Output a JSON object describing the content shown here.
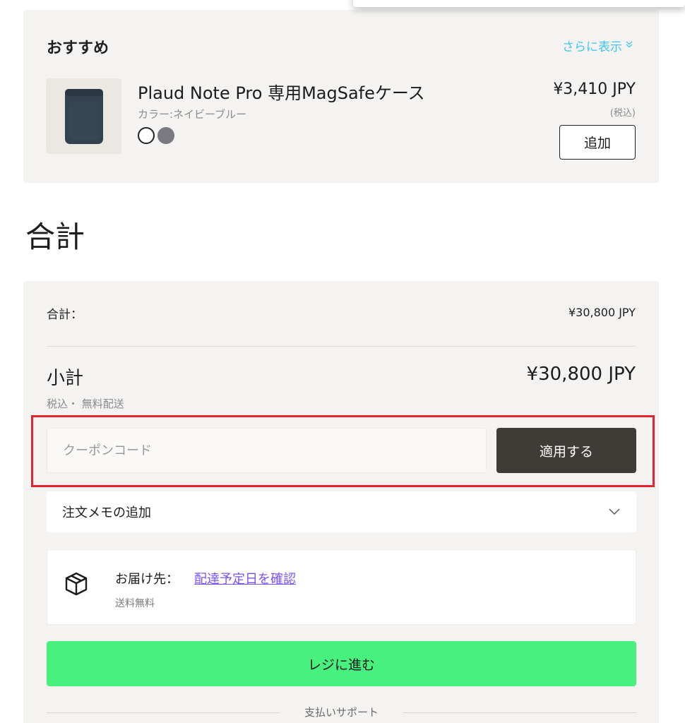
{
  "recommendations": {
    "title": "おすすめ",
    "show_more_label": "さらに表示",
    "product": {
      "name": "Plaud Note Pro 専用MagSafeケース",
      "variant": "カラー:ネイビーブルー",
      "price": "¥3,410 JPY",
      "tax_note": "(税込)",
      "add_label": "追加",
      "swatch_colors": [
        "#ffffff",
        "#7a7a80"
      ]
    }
  },
  "total_heading": "合計",
  "summary": {
    "total_label": "合計：",
    "total_value": "¥30,800 JPY",
    "subtotal_label": "小計",
    "subtotal_value": "¥30,800 JPY",
    "subtotal_note": "税込・ 無料配送",
    "coupon_placeholder": "クーポンコード",
    "apply_label": "適用する",
    "memo_label": "注文メモの追加",
    "delivery": {
      "label": "お届け先：",
      "link": "配達予定日を確認",
      "sub": "送料無料"
    },
    "checkout_label": "レジに進む",
    "support_label": "支払いサポート"
  },
  "colors": {
    "accent_link": "#3ec6ef",
    "apply_button": "#3f3b37",
    "checkout_button": "#48f07e",
    "highlight_frame": "#e3232e",
    "delivery_link": "#7a4ff0"
  }
}
